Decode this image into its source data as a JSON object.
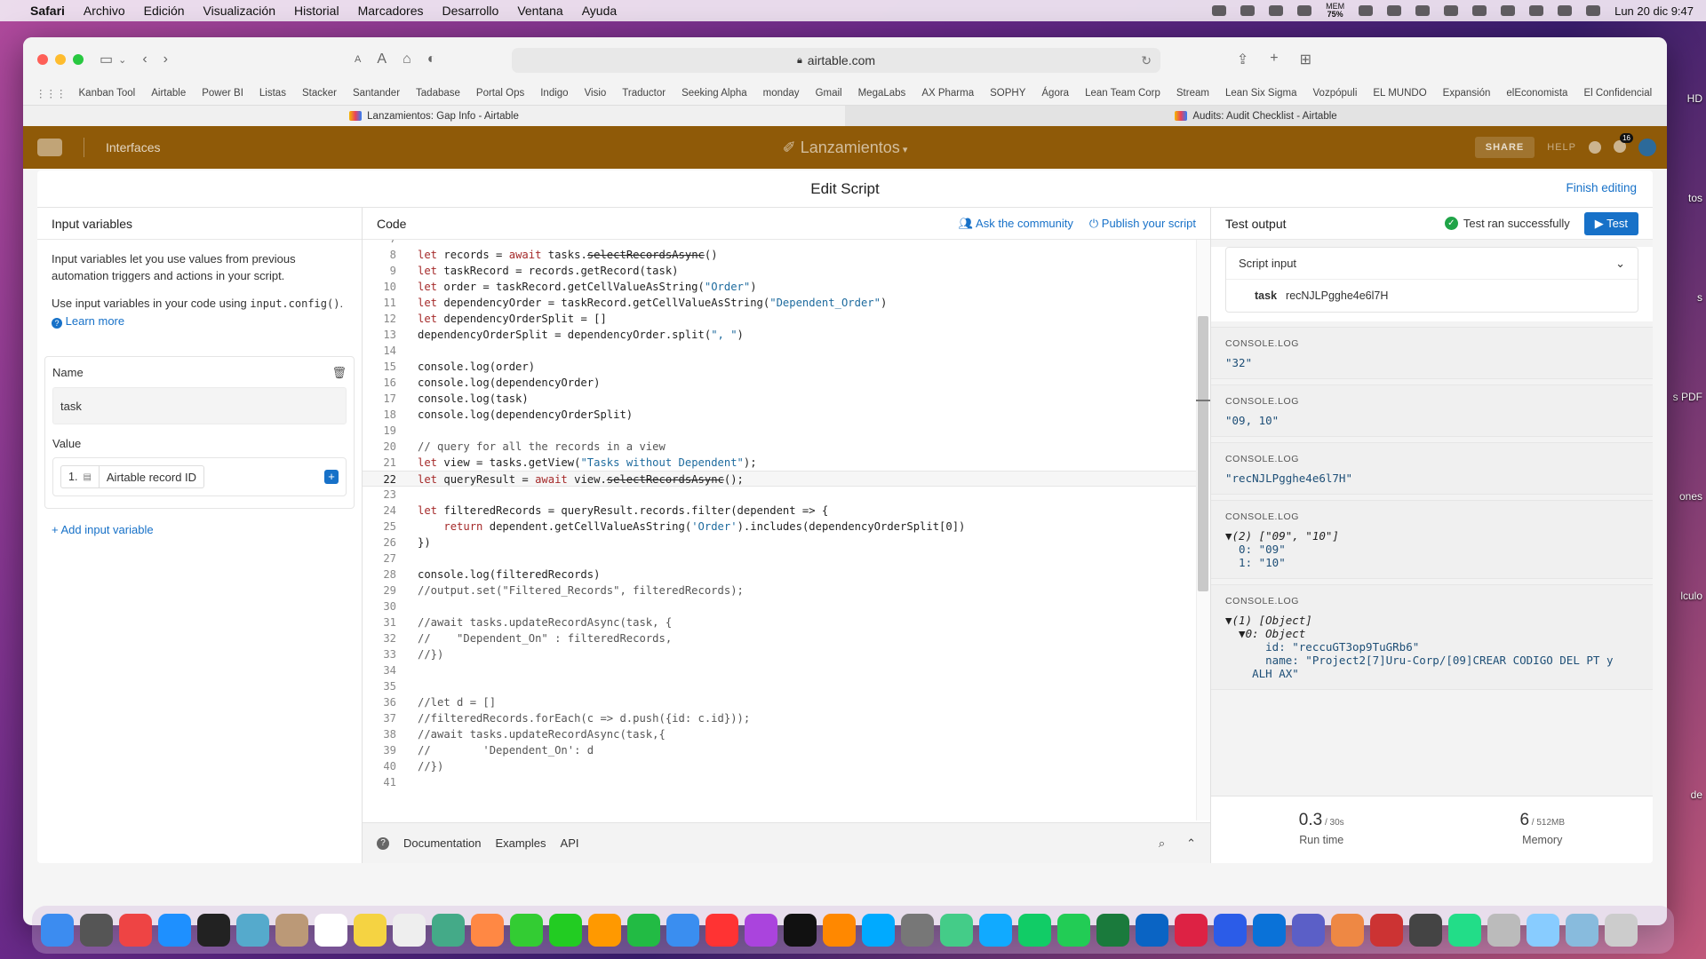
{
  "menubar": {
    "items": [
      "Safari",
      "Archivo",
      "Edición",
      "Visualización",
      "Historial",
      "Marcadores",
      "Desarrollo",
      "Ventana",
      "Ayuda"
    ],
    "mem_label": "MEM",
    "mem_value": "75%",
    "datetime": "Lun 20 dic  9:47"
  },
  "desktop_labels": [
    "HD",
    "tos",
    "s",
    "s PDF",
    "ones",
    "lculo",
    "de"
  ],
  "browser": {
    "url": "airtable.com",
    "bookmarks": [
      "Kanban Tool",
      "Airtable",
      "Power BI",
      "Listas",
      "Stacker",
      "Santander",
      "Tadabase",
      "Portal Ops",
      "Indigo",
      "Visio",
      "Traductor",
      "Seeking Alpha",
      "monday",
      "Gmail",
      "MegaLabs",
      "AX Pharma",
      "SOPHY",
      "Ágora",
      "Lean Team Corp",
      "Stream",
      "Lean Six Sigma",
      "Vozpópuli",
      "EL MUNDO",
      "Expansión",
      "elEconomista",
      "El Confidencial"
    ],
    "tabs": [
      "Lanzamientos: Gap Info - Airtable",
      "Audits: Audit Checklist - Airtable"
    ]
  },
  "airtable": {
    "interfaces": "Interfaces",
    "base_title": "Lanzamientos",
    "share": "SHARE",
    "help": "HELP",
    "notifications": "16"
  },
  "editor": {
    "title": "Edit Script",
    "finish": "Finish editing",
    "input_variables": {
      "title": "Input variables",
      "desc1": "Input variables let you use values from previous automation triggers and actions in your script.",
      "desc2_pre": "Use input variables in your code using",
      "desc2_code": "input.config()",
      "desc2_post": ".",
      "learn_more": "Learn more",
      "name_label": "Name",
      "name_value": "task",
      "value_label": "Value",
      "value_num": "1.",
      "value_type": "Airtable record ID",
      "add": "Add input variable"
    },
    "code": {
      "title": "Code",
      "ask": "Ask the community",
      "publish": "Publish your script",
      "footer": [
        "Documentation",
        "Examples",
        "API"
      ]
    },
    "output": {
      "title": "Test output",
      "status": "Test ran successfully",
      "test_btn": "Test",
      "script_input": "Script input",
      "input_key": "task",
      "input_val": "recNJLPgghe4e6l7H",
      "logs": [
        {
          "label": "CONSOLE.LOG",
          "lines": [
            "\"32\""
          ]
        },
        {
          "label": "CONSOLE.LOG",
          "lines": [
            "\"09, 10\""
          ]
        },
        {
          "label": "CONSOLE.LOG",
          "lines": [
            "\"recNJLPgghe4e6l7H\""
          ]
        },
        {
          "label": "CONSOLE.LOG",
          "lines": [
            "▼(2) [\"09\", \"10\"]",
            "  0: \"09\"",
            "  1: \"10\""
          ]
        },
        {
          "label": "CONSOLE.LOG",
          "lines": [
            "▼(1) [Object]",
            "  ▼0: Object",
            "      id: \"reccuGT3op9TuGRb6\"",
            "      name: \"Project2[7]Uru-Corp/[09]CREAR CODIGO DEL PT y",
            "    ALH AX\""
          ]
        }
      ],
      "runtime_val": "0.3",
      "runtime_max": " / 30s",
      "runtime_label": "Run time",
      "memory_val": "6",
      "memory_max": " / 512MB",
      "memory_label": "Memory"
    }
  },
  "code_lines": [
    {
      "n": "7",
      "t": ""
    },
    {
      "n": "8",
      "t": "let records = await tasks.selectRecordsAsync()"
    },
    {
      "n": "9",
      "t": "let taskRecord = records.getRecord(task)"
    },
    {
      "n": "10",
      "t": "let order = taskRecord.getCellValueAsString(\"Order\")"
    },
    {
      "n": "11",
      "t": "let dependencyOrder = taskRecord.getCellValueAsString(\"Dependent_Order\")"
    },
    {
      "n": "12",
      "t": "let dependencyOrderSplit = []"
    },
    {
      "n": "13",
      "t": "dependencyOrderSplit = dependencyOrder.split(\", \")"
    },
    {
      "n": "14",
      "t": ""
    },
    {
      "n": "15",
      "t": "console.log(order)"
    },
    {
      "n": "16",
      "t": "console.log(dependencyOrder)"
    },
    {
      "n": "17",
      "t": "console.log(task)"
    },
    {
      "n": "18",
      "t": "console.log(dependencyOrderSplit)"
    },
    {
      "n": "19",
      "t": ""
    },
    {
      "n": "20",
      "t": "// query for all the records in a view"
    },
    {
      "n": "21",
      "t": "let view = tasks.getView(\"Tasks without Dependent\");"
    },
    {
      "n": "22",
      "t": "let queryResult = await view.selectRecordsAsync();"
    },
    {
      "n": "23",
      "t": ""
    },
    {
      "n": "24",
      "t": "let filteredRecords = queryResult.records.filter(dependent => {"
    },
    {
      "n": "25",
      "t": "    return dependent.getCellValueAsString('Order').includes(dependencyOrderSplit[0])"
    },
    {
      "n": "26",
      "t": "})"
    },
    {
      "n": "27",
      "t": ""
    },
    {
      "n": "28",
      "t": "console.log(filteredRecords)"
    },
    {
      "n": "29",
      "t": "//output.set(\"Filtered_Records\", filteredRecords);"
    },
    {
      "n": "30",
      "t": ""
    },
    {
      "n": "31",
      "t": "//await tasks.updateRecordAsync(task, {"
    },
    {
      "n": "32",
      "t": "//    \"Dependent_On\" : filteredRecords,"
    },
    {
      "n": "33",
      "t": "//})"
    },
    {
      "n": "34",
      "t": ""
    },
    {
      "n": "35",
      "t": ""
    },
    {
      "n": "36",
      "t": "//let d = []"
    },
    {
      "n": "37",
      "t": "//filteredRecords.forEach(c => d.push({id: c.id}));"
    },
    {
      "n": "38",
      "t": "//await tasks.updateRecordAsync(task,{"
    },
    {
      "n": "39",
      "t": "//        'Dependent_On': d"
    },
    {
      "n": "40",
      "t": "//})"
    },
    {
      "n": "41",
      "t": ""
    }
  ],
  "current_line": "22",
  "colors": {
    "accent": "#1771c8",
    "header": "#8f5a08",
    "success": "#20a448"
  }
}
